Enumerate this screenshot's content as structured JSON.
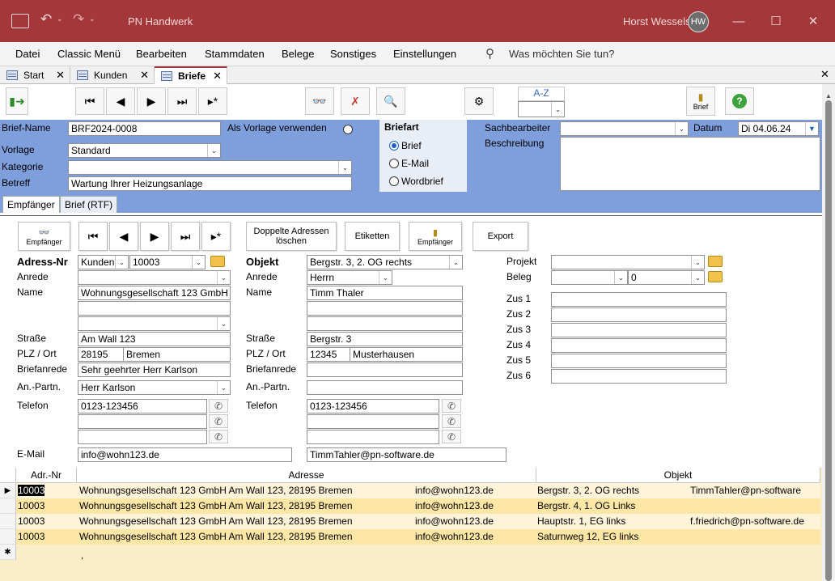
{
  "app": {
    "title": "PN Handwerk",
    "user": "Horst Wessels",
    "initials": "HW"
  },
  "menu": [
    "Datei",
    "Classic Menü",
    "Bearbeiten",
    "Stammdaten",
    "Belege",
    "Sonstiges",
    "Einstellungen"
  ],
  "tellme": "Was möchten Sie tun?",
  "tabs": [
    {
      "label": "Start"
    },
    {
      "label": "Kunden"
    },
    {
      "label": "Briefe"
    }
  ],
  "toolbar": {
    "sort_label": "A-Z",
    "brief_label": "Brief"
  },
  "header": {
    "briefname_label": "Brief-Name",
    "briefname": "BRF2024-0008",
    "vorlage_verwenden": "Als Vorlage verwenden",
    "vorlage_label": "Vorlage",
    "vorlage": "Standard",
    "kategorie_label": "Kategorie",
    "kategorie": "",
    "betreff_label": "Betreff",
    "betreff": "Wartung Ihrer Heizungsanlage",
    "briefart_label": "Briefart",
    "briefart_options": [
      "Brief",
      "E-Mail",
      "Wordbrief"
    ],
    "briefart_selected": "Brief",
    "sachbearbeiter_label": "Sachbearbeiter",
    "sachbearbeiter": "",
    "datum_label": "Datum",
    "datum": "Di 04.06.24",
    "beschreibung_label": "Beschreibung",
    "beschreibung": ""
  },
  "subtabs": [
    "Empfänger",
    "Brief (RTF)"
  ],
  "body": {
    "buttons": {
      "empfaenger": "Empfänger",
      "doppelte1": "Doppelte Adressen",
      "doppelte2": "löschen",
      "etiketten": "Etiketten",
      "empfaenger2": "Empfänger",
      "export": "Export"
    },
    "adress_nr_label": "Adress-Nr",
    "adress_typ": "Kunden",
    "adress_nr": "10003",
    "anrede_label": "Anrede",
    "anrede": "",
    "name_label": "Name",
    "name1": "Wohnungsgesellschaft 123 GmbH",
    "name2": "",
    "name3": "",
    "strasse_label": "Straße",
    "strasse": "Am Wall 123",
    "plz_label": "PLZ / Ort",
    "plz": "28195",
    "ort": "Bremen",
    "briefanrede_label": "Briefanrede",
    "briefanrede": "Sehr geehrter Herr Karlson",
    "anpartn_label": "An.-Partn.",
    "anpartn": "Herr Karlson",
    "telefon_label": "Telefon",
    "telefon": "0123-123456",
    "email_label": "E-Mail",
    "email": "info@wohn123.de",
    "objekt_label": "Objekt",
    "objekt": "Bergstr. 3, 2. OG rechts",
    "o_anrede": "Herrn",
    "o_name": "Timm Thaler",
    "o_strasse": "Bergstr. 3",
    "o_plz": "12345",
    "o_ort": "Musterhausen",
    "o_briefanrede": "",
    "o_anpartn": "",
    "o_telefon": "0123-123456",
    "o_email": "TimmTahler@pn-software.de",
    "projekt_label": "Projekt",
    "projekt": "",
    "beleg_label": "Beleg",
    "beleg": "0",
    "zus_labels": [
      "Zus 1",
      "Zus 2",
      "Zus 3",
      "Zus 4",
      "Zus 5",
      "Zus 6"
    ]
  },
  "grid": {
    "headers": [
      "Adr.-Nr",
      "Adresse",
      "Objekt"
    ],
    "rows": [
      {
        "nr": "10003",
        "adresse": "Wohnungsgesellschaft 123 GmbH Am Wall 123, 28195 Bremen",
        "email": "info@wohn123.de",
        "objekt": "Bergstr. 3, 2. OG rechts",
        "oemail": "TimmTahler@pn-software"
      },
      {
        "nr": "10003",
        "adresse": "Wohnungsgesellschaft 123 GmbH Am Wall 123, 28195 Bremen",
        "email": "info@wohn123.de",
        "objekt": "Bergstr. 4, 1. OG Links",
        "oemail": ""
      },
      {
        "nr": "10003",
        "adresse": "Wohnungsgesellschaft 123 GmbH Am Wall 123, 28195 Bremen",
        "email": "info@wohn123.de",
        "objekt": "Hauptstr. 1, EG links",
        "oemail": "f.friedrich@pn-software.de"
      },
      {
        "nr": "10003",
        "adresse": "Wohnungsgesellschaft 123 GmbH Am Wall 123, 28195 Bremen",
        "email": "info@wohn123.de",
        "objekt": "Saturnweg 12, EG links",
        "oemail": ""
      }
    ],
    "new_row_text": ","
  },
  "colors": {
    "titlebar": "#a4373a",
    "header_blue": "#7f9edc",
    "grid_bg": "#faeec8"
  }
}
